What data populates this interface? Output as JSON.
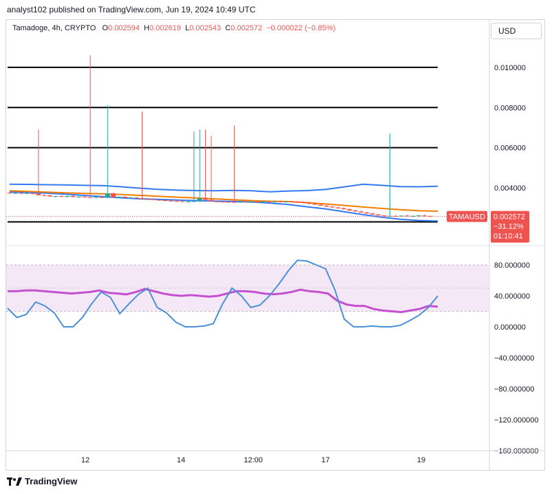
{
  "header": {
    "publisher": "analyst102 published on TradingView.com, Jun 19, 2024 10:49 UTC",
    "symbol": "Tamadoge, 4h, CRYPTO",
    "open_label": "O",
    "open": "0.002594",
    "high_label": "H",
    "high": "0.002619",
    "low_label": "L",
    "low": "0.002543",
    "close_label": "C",
    "close": "0.002572",
    "change": "−0.000022 (−0.85%)",
    "currency": "USD"
  },
  "price_badge": {
    "symbol": "TAMAUSD",
    "price": "0.002572",
    "change_pct": "−31.12%",
    "countdown": "01:10:41"
  },
  "footer": {
    "brand": "TradingView"
  },
  "colors": {
    "up": "#26a69a",
    "down": "#ef5350",
    "band": "#3179f5",
    "ma": "#f57c00",
    "stoch_k": "#4a8fd8",
    "stoch_d": "#c44fd1",
    "rsi_fill": "#f3e5f5"
  },
  "chart_data": [
    {
      "type": "candlestick",
      "title": "Tamadoge, 4h, CRYPTO",
      "x_ticks": [
        "12",
        "14",
        "12:00",
        "17",
        "19"
      ],
      "y_ticks": [
        "0.010000",
        "0.008000",
        "0.006000",
        "0.004000"
      ],
      "ylim": [
        0.0017,
        0.0113
      ],
      "horizontal_levels": [
        0.01,
        0.008,
        0.006,
        0.0023
      ],
      "candles": [
        {
          "o": 0.00375,
          "h": 0.00378,
          "l": 0.00371,
          "c": 0.00373
        },
        {
          "o": 0.00373,
          "h": 0.00377,
          "l": 0.00369,
          "c": 0.00374
        },
        {
          "o": 0.00374,
          "h": 0.00378,
          "l": 0.00369,
          "c": 0.00372
        },
        {
          "o": 0.00372,
          "h": 0.00376,
          "l": 0.00368,
          "c": 0.00373
        },
        {
          "o": 0.00373,
          "h": 0.00377,
          "l": 0.00369,
          "c": 0.00371
        },
        {
          "o": 0.00371,
          "h": 0.0069,
          "l": 0.00362,
          "c": 0.00363
        },
        {
          "o": 0.00363,
          "h": 0.00367,
          "l": 0.00358,
          "c": 0.00362
        },
        {
          "o": 0.00362,
          "h": 0.00365,
          "l": 0.00355,
          "c": 0.00357
        },
        {
          "o": 0.00357,
          "h": 0.0036,
          "l": 0.00352,
          "c": 0.00358
        },
        {
          "o": 0.00358,
          "h": 0.00362,
          "l": 0.00352,
          "c": 0.00355
        },
        {
          "o": 0.00355,
          "h": 0.0036,
          "l": 0.00351,
          "c": 0.00359
        },
        {
          "o": 0.00359,
          "h": 0.00363,
          "l": 0.00352,
          "c": 0.00354
        },
        {
          "o": 0.00354,
          "h": 0.00358,
          "l": 0.0035,
          "c": 0.00356
        },
        {
          "o": 0.00356,
          "h": 0.0036,
          "l": 0.0035,
          "c": 0.00353
        },
        {
          "o": 0.00353,
          "h": 0.0106,
          "l": 0.00348,
          "c": 0.00352
        },
        {
          "o": 0.00352,
          "h": 0.00356,
          "l": 0.00347,
          "c": 0.00354
        },
        {
          "o": 0.00354,
          "h": 0.00357,
          "l": 0.00348,
          "c": 0.0035
        },
        {
          "o": 0.0035,
          "h": 0.0081,
          "l": 0.00347,
          "c": 0.00372
        },
        {
          "o": 0.00372,
          "h": 0.00376,
          "l": 0.0035,
          "c": 0.00352
        },
        {
          "o": 0.00352,
          "h": 0.00358,
          "l": 0.00348,
          "c": 0.00355
        },
        {
          "o": 0.00355,
          "h": 0.00358,
          "l": 0.00348,
          "c": 0.0035
        },
        {
          "o": 0.0035,
          "h": 0.00354,
          "l": 0.00345,
          "c": 0.00351
        },
        {
          "o": 0.00351,
          "h": 0.00355,
          "l": 0.00345,
          "c": 0.00347
        },
        {
          "o": 0.00347,
          "h": 0.0078,
          "l": 0.00342,
          "c": 0.00344
        },
        {
          "o": 0.00344,
          "h": 0.00348,
          "l": 0.00339,
          "c": 0.00343
        },
        {
          "o": 0.00343,
          "h": 0.00347,
          "l": 0.00338,
          "c": 0.0034
        },
        {
          "o": 0.0034,
          "h": 0.00344,
          "l": 0.00335,
          "c": 0.00338
        },
        {
          "o": 0.00338,
          "h": 0.00342,
          "l": 0.00333,
          "c": 0.00336
        },
        {
          "o": 0.00336,
          "h": 0.0034,
          "l": 0.00331,
          "c": 0.00334
        },
        {
          "o": 0.00334,
          "h": 0.00338,
          "l": 0.0033,
          "c": 0.00333
        },
        {
          "o": 0.00333,
          "h": 0.00336,
          "l": 0.00328,
          "c": 0.00331
        },
        {
          "o": 0.00331,
          "h": 0.00335,
          "l": 0.00327,
          "c": 0.00332
        },
        {
          "o": 0.00332,
          "h": 0.0068,
          "l": 0.00327,
          "c": 0.00334
        },
        {
          "o": 0.00334,
          "h": 0.0069,
          "l": 0.00328,
          "c": 0.00348
        },
        {
          "o": 0.00348,
          "h": 0.0069,
          "l": 0.00337,
          "c": 0.0034
        },
        {
          "o": 0.0034,
          "h": 0.0066,
          "l": 0.00332,
          "c": 0.00332
        },
        {
          "o": 0.00332,
          "h": 0.00336,
          "l": 0.00328,
          "c": 0.00331
        },
        {
          "o": 0.00331,
          "h": 0.00335,
          "l": 0.00326,
          "c": 0.0033
        },
        {
          "o": 0.0033,
          "h": 0.00334,
          "l": 0.00325,
          "c": 0.00329
        },
        {
          "o": 0.00329,
          "h": 0.0071,
          "l": 0.00325,
          "c": 0.00328
        },
        {
          "o": 0.00328,
          "h": 0.00332,
          "l": 0.00324,
          "c": 0.0033
        },
        {
          "o": 0.0033,
          "h": 0.00334,
          "l": 0.00325,
          "c": 0.00329
        },
        {
          "o": 0.00329,
          "h": 0.00333,
          "l": 0.00324,
          "c": 0.00331
        },
        {
          "o": 0.00331,
          "h": 0.00335,
          "l": 0.00326,
          "c": 0.0033
        },
        {
          "o": 0.0033,
          "h": 0.00334,
          "l": 0.00325,
          "c": 0.00332
        },
        {
          "o": 0.00332,
          "h": 0.00336,
          "l": 0.00327,
          "c": 0.00331
        },
        {
          "o": 0.00331,
          "h": 0.00335,
          "l": 0.00326,
          "c": 0.00332
        },
        {
          "o": 0.00332,
          "h": 0.00336,
          "l": 0.00327,
          "c": 0.0033
        },
        {
          "o": 0.0033,
          "h": 0.00334,
          "l": 0.00325,
          "c": 0.00331
        },
        {
          "o": 0.00331,
          "h": 0.00335,
          "l": 0.00326,
          "c": 0.00329
        },
        {
          "o": 0.00329,
          "h": 0.00333,
          "l": 0.00324,
          "c": 0.00328
        },
        {
          "o": 0.00328,
          "h": 0.00332,
          "l": 0.00322,
          "c": 0.00325
        },
        {
          "o": 0.00325,
          "h": 0.00329,
          "l": 0.00318,
          "c": 0.0032
        },
        {
          "o": 0.0032,
          "h": 0.00324,
          "l": 0.00314,
          "c": 0.00316
        },
        {
          "o": 0.00316,
          "h": 0.0032,
          "l": 0.0031,
          "c": 0.00311
        },
        {
          "o": 0.00311,
          "h": 0.00314,
          "l": 0.00305,
          "c": 0.00306
        },
        {
          "o": 0.00306,
          "h": 0.0031,
          "l": 0.00301,
          "c": 0.00302
        },
        {
          "o": 0.00302,
          "h": 0.00306,
          "l": 0.00296,
          "c": 0.00298
        },
        {
          "o": 0.00298,
          "h": 0.00302,
          "l": 0.00292,
          "c": 0.00293
        },
        {
          "o": 0.00293,
          "h": 0.00297,
          "l": 0.00286,
          "c": 0.00287
        },
        {
          "o": 0.00287,
          "h": 0.00291,
          "l": 0.00281,
          "c": 0.00282
        },
        {
          "o": 0.00282,
          "h": 0.00285,
          "l": 0.00276,
          "c": 0.00277
        },
        {
          "o": 0.00277,
          "h": 0.0028,
          "l": 0.00271,
          "c": 0.00272
        },
        {
          "o": 0.00272,
          "h": 0.00275,
          "l": 0.00266,
          "c": 0.00267
        },
        {
          "o": 0.00267,
          "h": 0.0027,
          "l": 0.00261,
          "c": 0.00262
        },
        {
          "o": 0.00262,
          "h": 0.00265,
          "l": 0.00256,
          "c": 0.00258
        },
        {
          "o": 0.00258,
          "h": 0.0067,
          "l": 0.00255,
          "c": 0.0026
        },
        {
          "o": 0.0026,
          "h": 0.00264,
          "l": 0.00255,
          "c": 0.00259
        },
        {
          "o": 0.00259,
          "h": 0.00263,
          "l": 0.00254,
          "c": 0.00261
        },
        {
          "o": 0.00261,
          "h": 0.00265,
          "l": 0.00256,
          "c": 0.00259
        },
        {
          "o": 0.00259,
          "h": 0.00263,
          "l": 0.00254,
          "c": 0.0026
        },
        {
          "o": 0.0026,
          "h": 0.00264,
          "l": 0.00255,
          "c": 0.00262
        },
        {
          "o": 0.00262,
          "h": 0.00266,
          "l": 0.00256,
          "c": 0.00259
        },
        {
          "o": 0.002594,
          "h": 0.002619,
          "l": 0.002543,
          "c": 0.002572
        }
      ],
      "bands": {
        "upper": [
          0.00418,
          0.00417,
          0.00415,
          0.00414,
          0.00412,
          0.00411,
          0.00405,
          0.00398,
          0.00392,
          0.00388,
          0.00386,
          0.00385,
          0.00387,
          0.00385,
          0.0038,
          0.00384,
          0.00386,
          0.00392,
          0.00405,
          0.00418,
          0.00412,
          0.00406,
          0.00405,
          0.00408
        ],
        "middle": [
          0.00385,
          0.00382,
          0.00378,
          0.00375,
          0.00372,
          0.0037,
          0.00366,
          0.00362,
          0.00358,
          0.00353,
          0.00349,
          0.00345,
          0.0034,
          0.00336,
          0.00333,
          0.00331,
          0.00326,
          0.00319,
          0.00312,
          0.00304,
          0.00297,
          0.00291,
          0.00286,
          0.00283
        ],
        "lower": [
          0.00379,
          0.00377,
          0.00373,
          0.00368,
          0.00362,
          0.00356,
          0.0035,
          0.00345,
          0.00342,
          0.00339,
          0.00336,
          0.00334,
          0.00332,
          0.00329,
          0.00324,
          0.00316,
          0.00305,
          0.00294,
          0.0028,
          0.00266,
          0.00253,
          0.00243,
          0.00237,
          0.00234
        ]
      }
    },
    {
      "type": "line",
      "title": "",
      "y_ticks": [
        "80.000000",
        "40.000000",
        "0.000000",
        "−40.000000",
        "−80.000000",
        "−120.000000",
        "−160.000000"
      ],
      "ylim": [
        -160,
        100
      ],
      "overbought": 80,
      "oversold": 20,
      "series": [
        {
          "values": [
            24,
            12,
            16,
            32,
            27,
            18,
            0,
            0,
            12,
            30,
            45,
            38,
            17,
            30,
            42,
            50,
            25,
            18,
            6,
            0,
            0,
            1,
            4,
            30,
            50,
            40,
            25,
            28,
            40,
            55,
            72,
            86,
            85,
            80,
            75,
            48,
            10,
            0,
            0,
            1,
            0,
            0,
            2,
            8,
            15,
            25,
            40
          ]
        },
        {
          "values": [
            46,
            46,
            47,
            47,
            46,
            45,
            44,
            43,
            44,
            45,
            47,
            44,
            43,
            42,
            45,
            49,
            46,
            43,
            41,
            40,
            41,
            40,
            39,
            40,
            43,
            46,
            46,
            45,
            43,
            42,
            43,
            45,
            48,
            46,
            45,
            43,
            34,
            29,
            27,
            27,
            23,
            21,
            20,
            19,
            21,
            23,
            27,
            26
          ]
        }
      ]
    }
  ]
}
